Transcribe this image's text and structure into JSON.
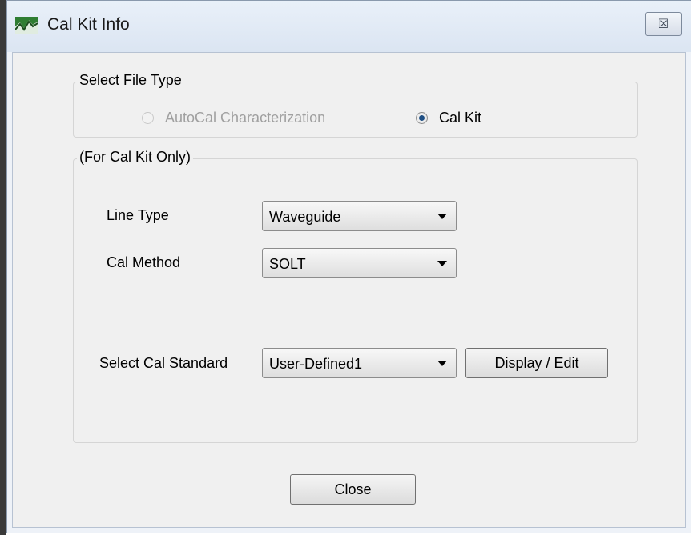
{
  "window": {
    "title": "Cal Kit Info",
    "close_glyph": "☒"
  },
  "file_type": {
    "group_label": "Select File Type",
    "options": [
      {
        "label": "AutoCal Characterization",
        "selected": false,
        "enabled": false
      },
      {
        "label": "Cal Kit",
        "selected": true,
        "enabled": true
      }
    ]
  },
  "cal_kit": {
    "group_label": "(For Cal Kit Only)",
    "line_type": {
      "label": "Line Type",
      "value": "Waveguide"
    },
    "cal_method": {
      "label": "Cal Method",
      "value": "SOLT"
    },
    "cal_standard": {
      "label": "Select Cal Standard",
      "value": "User-Defined1"
    },
    "display_edit_label": "Display / Edit"
  },
  "footer": {
    "close_label": "Close"
  },
  "icons": {
    "app_icon": "cal-kit-app-icon",
    "window_close": "close-icon",
    "dropdown": "chevron-down-icon"
  },
  "colors": {
    "title_bar": "#dbe5f2",
    "dialog_background": "#f0f0f0",
    "radio_selected": "#1f4f84",
    "disabled_text": "#a0a0a0"
  }
}
